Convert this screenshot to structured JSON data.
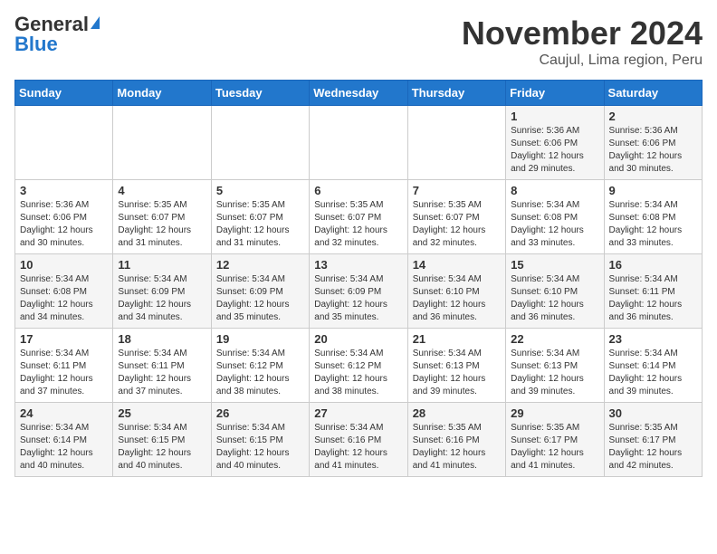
{
  "header": {
    "logo_general": "General",
    "logo_blue": "Blue",
    "title": "November 2024",
    "location": "Caujul, Lima region, Peru"
  },
  "days_of_week": [
    "Sunday",
    "Monday",
    "Tuesday",
    "Wednesday",
    "Thursday",
    "Friday",
    "Saturday"
  ],
  "weeks": [
    [
      {
        "day": "",
        "info": ""
      },
      {
        "day": "",
        "info": ""
      },
      {
        "day": "",
        "info": ""
      },
      {
        "day": "",
        "info": ""
      },
      {
        "day": "",
        "info": ""
      },
      {
        "day": "1",
        "info": "Sunrise: 5:36 AM\nSunset: 6:06 PM\nDaylight: 12 hours and 29 minutes."
      },
      {
        "day": "2",
        "info": "Sunrise: 5:36 AM\nSunset: 6:06 PM\nDaylight: 12 hours and 30 minutes."
      }
    ],
    [
      {
        "day": "3",
        "info": "Sunrise: 5:36 AM\nSunset: 6:06 PM\nDaylight: 12 hours and 30 minutes."
      },
      {
        "day": "4",
        "info": "Sunrise: 5:35 AM\nSunset: 6:07 PM\nDaylight: 12 hours and 31 minutes."
      },
      {
        "day": "5",
        "info": "Sunrise: 5:35 AM\nSunset: 6:07 PM\nDaylight: 12 hours and 31 minutes."
      },
      {
        "day": "6",
        "info": "Sunrise: 5:35 AM\nSunset: 6:07 PM\nDaylight: 12 hours and 32 minutes."
      },
      {
        "day": "7",
        "info": "Sunrise: 5:35 AM\nSunset: 6:07 PM\nDaylight: 12 hours and 32 minutes."
      },
      {
        "day": "8",
        "info": "Sunrise: 5:34 AM\nSunset: 6:08 PM\nDaylight: 12 hours and 33 minutes."
      },
      {
        "day": "9",
        "info": "Sunrise: 5:34 AM\nSunset: 6:08 PM\nDaylight: 12 hours and 33 minutes."
      }
    ],
    [
      {
        "day": "10",
        "info": "Sunrise: 5:34 AM\nSunset: 6:08 PM\nDaylight: 12 hours and 34 minutes."
      },
      {
        "day": "11",
        "info": "Sunrise: 5:34 AM\nSunset: 6:09 PM\nDaylight: 12 hours and 34 minutes."
      },
      {
        "day": "12",
        "info": "Sunrise: 5:34 AM\nSunset: 6:09 PM\nDaylight: 12 hours and 35 minutes."
      },
      {
        "day": "13",
        "info": "Sunrise: 5:34 AM\nSunset: 6:09 PM\nDaylight: 12 hours and 35 minutes."
      },
      {
        "day": "14",
        "info": "Sunrise: 5:34 AM\nSunset: 6:10 PM\nDaylight: 12 hours and 36 minutes."
      },
      {
        "day": "15",
        "info": "Sunrise: 5:34 AM\nSunset: 6:10 PM\nDaylight: 12 hours and 36 minutes."
      },
      {
        "day": "16",
        "info": "Sunrise: 5:34 AM\nSunset: 6:11 PM\nDaylight: 12 hours and 36 minutes."
      }
    ],
    [
      {
        "day": "17",
        "info": "Sunrise: 5:34 AM\nSunset: 6:11 PM\nDaylight: 12 hours and 37 minutes."
      },
      {
        "day": "18",
        "info": "Sunrise: 5:34 AM\nSunset: 6:11 PM\nDaylight: 12 hours and 37 minutes."
      },
      {
        "day": "19",
        "info": "Sunrise: 5:34 AM\nSunset: 6:12 PM\nDaylight: 12 hours and 38 minutes."
      },
      {
        "day": "20",
        "info": "Sunrise: 5:34 AM\nSunset: 6:12 PM\nDaylight: 12 hours and 38 minutes."
      },
      {
        "day": "21",
        "info": "Sunrise: 5:34 AM\nSunset: 6:13 PM\nDaylight: 12 hours and 39 minutes."
      },
      {
        "day": "22",
        "info": "Sunrise: 5:34 AM\nSunset: 6:13 PM\nDaylight: 12 hours and 39 minutes."
      },
      {
        "day": "23",
        "info": "Sunrise: 5:34 AM\nSunset: 6:14 PM\nDaylight: 12 hours and 39 minutes."
      }
    ],
    [
      {
        "day": "24",
        "info": "Sunrise: 5:34 AM\nSunset: 6:14 PM\nDaylight: 12 hours and 40 minutes."
      },
      {
        "day": "25",
        "info": "Sunrise: 5:34 AM\nSunset: 6:15 PM\nDaylight: 12 hours and 40 minutes."
      },
      {
        "day": "26",
        "info": "Sunrise: 5:34 AM\nSunset: 6:15 PM\nDaylight: 12 hours and 40 minutes."
      },
      {
        "day": "27",
        "info": "Sunrise: 5:34 AM\nSunset: 6:16 PM\nDaylight: 12 hours and 41 minutes."
      },
      {
        "day": "28",
        "info": "Sunrise: 5:35 AM\nSunset: 6:16 PM\nDaylight: 12 hours and 41 minutes."
      },
      {
        "day": "29",
        "info": "Sunrise: 5:35 AM\nSunset: 6:17 PM\nDaylight: 12 hours and 41 minutes."
      },
      {
        "day": "30",
        "info": "Sunrise: 5:35 AM\nSunset: 6:17 PM\nDaylight: 12 hours and 42 minutes."
      }
    ]
  ]
}
